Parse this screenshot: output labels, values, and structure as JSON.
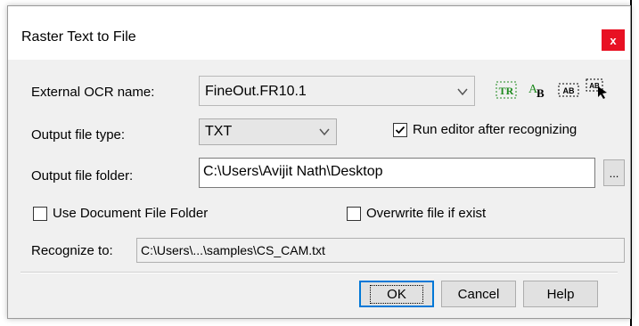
{
  "dialog": {
    "title": "Raster Text to File",
    "close_label": "x"
  },
  "ocr": {
    "label": "External OCR name:",
    "value": "FineOut.FR10.1"
  },
  "toolbar": {
    "icons": [
      "tr-icon",
      "ab-glyph-icon",
      "ab-box-icon",
      "ab-select-icon"
    ],
    "tr_text": "TR",
    "ab_text": "AB",
    "abl_text": "AB",
    "abs_text": "AB"
  },
  "output_type": {
    "label": "Output file type:",
    "value": "TXT"
  },
  "run_editor": {
    "label": "Run editor after recognizing",
    "checked": true
  },
  "output_folder": {
    "label": "Output file folder:",
    "value": "C:\\Users\\Avijit Nath\\Desktop",
    "browse_label": "..."
  },
  "use_doc_folder": {
    "label": "Use Document File Folder",
    "checked": false
  },
  "overwrite": {
    "label": "Overwrite file if exist",
    "checked": false
  },
  "recognize_to": {
    "label": "Recognize to:",
    "value": "C:\\Users\\...\\samples\\CS_CAM.txt"
  },
  "buttons": {
    "ok": "OK",
    "cancel": "Cancel",
    "help": "Help"
  },
  "colors": {
    "close_red": "#e81123",
    "focus_blue": "#0078d7",
    "icon_green": "#1e8a1e"
  }
}
